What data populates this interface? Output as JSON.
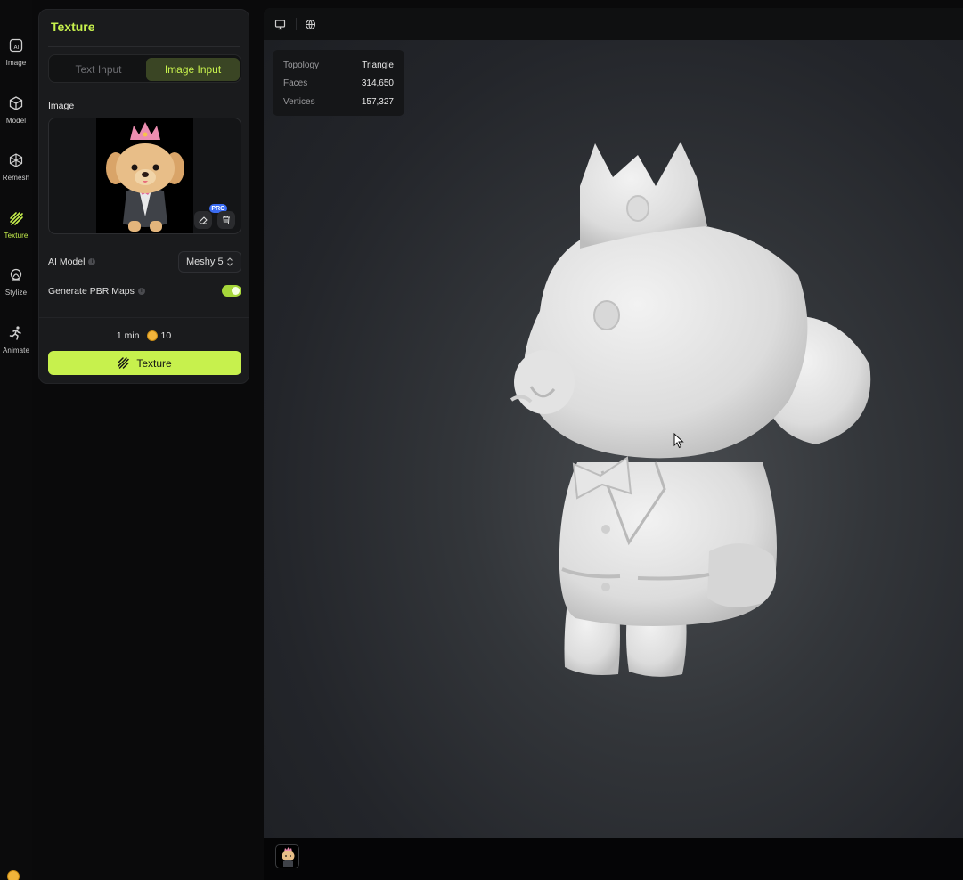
{
  "rail": {
    "items": [
      {
        "label": "Image",
        "icon": "image-ai-icon"
      },
      {
        "label": "Model",
        "icon": "cube-icon"
      },
      {
        "label": "Remesh",
        "icon": "remesh-icon"
      },
      {
        "label": "Texture",
        "icon": "texture-hatch-icon",
        "active": true
      },
      {
        "label": "Stylize",
        "icon": "stylize-icon"
      },
      {
        "label": "Animate",
        "icon": "running-figure-icon"
      }
    ]
  },
  "panel": {
    "title": "Texture",
    "tabs": {
      "text_input": "Text Input",
      "image_input": "Image Input",
      "active": "Image Input"
    },
    "image_label": "Image",
    "pro_badge": "PRO",
    "ai_model_label": "AI Model",
    "ai_model_value": "Meshy 5",
    "pbr_label": "Generate PBR Maps",
    "pbr_enabled": true,
    "time_estimate": "1 min",
    "credits": "10",
    "cta_label": "Texture"
  },
  "stats": {
    "rows": [
      {
        "key": "Topology",
        "value": "Triangle"
      },
      {
        "key": "Faces",
        "value": "314,650"
      },
      {
        "key": "Vertices",
        "value": "157,327"
      }
    ]
  },
  "colors": {
    "accent": "#c7f14d",
    "panel_bg": "#1a1b1d",
    "pro": "#3b6cf2"
  }
}
